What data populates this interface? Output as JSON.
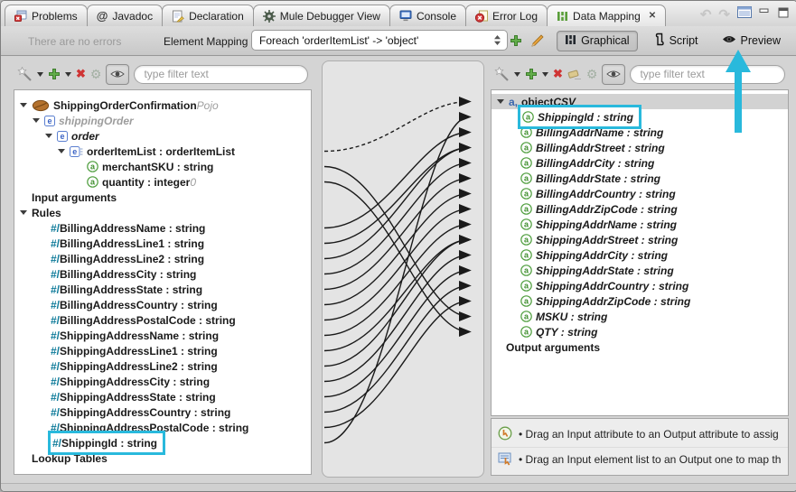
{
  "tabbar": {
    "tabs": [
      {
        "label": "Problems",
        "icon": "problems"
      },
      {
        "label": "Javadoc",
        "icon": "javadoc"
      },
      {
        "label": "Declaration",
        "icon": "declaration"
      },
      {
        "label": "Mule Debugger View",
        "icon": "mule-debugger"
      },
      {
        "label": "Console",
        "icon": "console"
      },
      {
        "label": "Error Log",
        "icon": "error-log"
      },
      {
        "label": "Data Mapping",
        "icon": "data-mapping",
        "active": true,
        "closable": true
      }
    ]
  },
  "toolbar": {
    "status": "There are no errors",
    "element_mapping_label": "Element Mapping",
    "mapping_select_value": "Foreach 'orderItemList' -> 'object'",
    "views": {
      "graphical": "Graphical",
      "script": "Script",
      "preview": "Preview",
      "active": "Graphical"
    }
  },
  "left_panel": {
    "filter_placeholder": "type filter text",
    "rows": [
      {
        "ind": 6,
        "exp": true,
        "icon": "bean",
        "segs": [
          [
            "ShippingOrderConfirmation ",
            "b"
          ],
          [
            "Pojo",
            "gi"
          ]
        ]
      },
      {
        "ind": 20,
        "exp": true,
        "icon": "e",
        "segs": [
          [
            "shippingOrder",
            "gib"
          ]
        ]
      },
      {
        "ind": 34,
        "exp": true,
        "icon": "e",
        "segs": [
          [
            "order",
            "i"
          ]
        ]
      },
      {
        "ind": 48,
        "exp": true,
        "icon": "elist",
        "segs": [
          [
            "orderItemList : orderItemList",
            "b"
          ]
        ]
      },
      {
        "ind": 80,
        "icon": "a",
        "segs": [
          [
            "merchantSKU : string",
            "b"
          ]
        ]
      },
      {
        "ind": 80,
        "icon": "a",
        "segs": [
          [
            "quantity : integer ",
            "b"
          ],
          [
            "0",
            "gi"
          ]
        ]
      },
      {
        "ind": 19,
        "segs": [
          [
            "Input arguments",
            "b"
          ]
        ]
      },
      {
        "ind": 6,
        "exp": true,
        "segs": [
          [
            "Rules",
            "b"
          ]
        ]
      },
      {
        "ind": 40,
        "segs": [
          [
            "#/ ",
            "hash"
          ],
          [
            "BillingAddressName : string",
            "b"
          ]
        ]
      },
      {
        "ind": 40,
        "segs": [
          [
            "#/ ",
            "hash"
          ],
          [
            "BillingAddressLine1 : string",
            "b"
          ]
        ]
      },
      {
        "ind": 40,
        "segs": [
          [
            "#/ ",
            "hash"
          ],
          [
            "BillingAddressLine2 : string",
            "b"
          ]
        ]
      },
      {
        "ind": 40,
        "segs": [
          [
            "#/ ",
            "hash"
          ],
          [
            "BillingAddressCity : string",
            "b"
          ]
        ]
      },
      {
        "ind": 40,
        "segs": [
          [
            "#/ ",
            "hash"
          ],
          [
            "BillingAddressState : string",
            "b"
          ]
        ]
      },
      {
        "ind": 40,
        "segs": [
          [
            "#/ ",
            "hash"
          ],
          [
            "BillingAddressCountry : string",
            "b"
          ]
        ]
      },
      {
        "ind": 40,
        "segs": [
          [
            "#/ ",
            "hash"
          ],
          [
            "BillingAddressPostalCode : string",
            "b"
          ]
        ]
      },
      {
        "ind": 40,
        "segs": [
          [
            "#/ ",
            "hash"
          ],
          [
            "ShippingAddressName : string",
            "b"
          ]
        ]
      },
      {
        "ind": 40,
        "segs": [
          [
            "#/ ",
            "hash"
          ],
          [
            "ShippingAddressLine1 : string",
            "b"
          ]
        ]
      },
      {
        "ind": 40,
        "segs": [
          [
            "#/ ",
            "hash"
          ],
          [
            "ShippingAddressLine2 : string",
            "b"
          ]
        ]
      },
      {
        "ind": 40,
        "segs": [
          [
            "#/ ",
            "hash"
          ],
          [
            "ShippingAddressCity : string",
            "b"
          ]
        ]
      },
      {
        "ind": 40,
        "segs": [
          [
            "#/ ",
            "hash"
          ],
          [
            "ShippingAddressState : string",
            "b"
          ]
        ]
      },
      {
        "ind": 40,
        "segs": [
          [
            "#/ ",
            "hash"
          ],
          [
            "ShippingAddressCountry : string",
            "b"
          ]
        ]
      },
      {
        "ind": 40,
        "segs": [
          [
            "#/ ",
            "hash"
          ],
          [
            "ShippingAddressPostalCode : string",
            "b"
          ]
        ]
      },
      {
        "ind": 40,
        "hl": true,
        "segs": [
          [
            "#/ ",
            "hash"
          ],
          [
            "ShippingId : string",
            "b"
          ]
        ]
      },
      {
        "ind": 19,
        "segs": [
          [
            "Lookup Tables",
            "b"
          ]
        ]
      }
    ]
  },
  "right_panel": {
    "filter_placeholder": "type filter text",
    "rows": [
      {
        "ind": 6,
        "exp": true,
        "icon": "acomma",
        "band": true,
        "segs": [
          [
            "object ",
            "b"
          ],
          [
            "CSV",
            "i"
          ]
        ]
      },
      {
        "ind": 32,
        "icon": "a",
        "hl": true,
        "segs": [
          [
            "ShippingId : string",
            "i"
          ]
        ]
      },
      {
        "ind": 32,
        "icon": "a",
        "segs": [
          [
            "BillingAddrName : string",
            "i"
          ]
        ]
      },
      {
        "ind": 32,
        "icon": "a",
        "segs": [
          [
            "BillingAddrStreet : string",
            "i"
          ]
        ]
      },
      {
        "ind": 32,
        "icon": "a",
        "segs": [
          [
            "BillingAddrCity : string",
            "i"
          ]
        ]
      },
      {
        "ind": 32,
        "icon": "a",
        "segs": [
          [
            "BillingAddrState : string",
            "i"
          ]
        ]
      },
      {
        "ind": 32,
        "icon": "a",
        "segs": [
          [
            "BillingAddrCountry : string",
            "i"
          ]
        ]
      },
      {
        "ind": 32,
        "icon": "a",
        "segs": [
          [
            "BillingAddrZipCode : string",
            "i"
          ]
        ]
      },
      {
        "ind": 32,
        "icon": "a",
        "segs": [
          [
            "ShippingAddrName : string",
            "i"
          ]
        ]
      },
      {
        "ind": 32,
        "icon": "a",
        "segs": [
          [
            "ShippingAddrStreet : string",
            "i"
          ]
        ]
      },
      {
        "ind": 32,
        "icon": "a",
        "segs": [
          [
            "ShippingAddrCity : string",
            "i"
          ]
        ]
      },
      {
        "ind": 32,
        "icon": "a",
        "segs": [
          [
            "ShippingAddrState : string",
            "i"
          ]
        ]
      },
      {
        "ind": 32,
        "icon": "a",
        "segs": [
          [
            "ShippingAddrCountry : string",
            "i"
          ]
        ]
      },
      {
        "ind": 32,
        "icon": "a",
        "segs": [
          [
            "ShippingAddrZipCode : string",
            "i"
          ]
        ]
      },
      {
        "ind": 32,
        "icon": "a",
        "segs": [
          [
            "MSKU : string",
            "i"
          ]
        ]
      },
      {
        "ind": 32,
        "icon": "a",
        "segs": [
          [
            "QTY : string",
            "i"
          ]
        ]
      },
      {
        "ind": 16,
        "segs": [
          [
            "Output arguments",
            "b"
          ]
        ]
      }
    ],
    "hints": [
      {
        "icon": "hint-attribute",
        "text": "• Drag an Input attribute to an Output attribute to assig"
      },
      {
        "icon": "hint-element-list",
        "text": "• Drag an Input element list to an Output one to map th"
      }
    ]
  },
  "connections": [
    {
      "from": 3,
      "to": 0,
      "dashed": true
    },
    {
      "from": 4,
      "to": 14
    },
    {
      "from": 5,
      "to": 15
    },
    {
      "from": 8,
      "to": 2
    },
    {
      "from": 9,
      "to": 3
    },
    {
      "from": 10,
      "to": 3
    },
    {
      "from": 11,
      "to": 4
    },
    {
      "from": 12,
      "to": 5
    },
    {
      "from": 13,
      "to": 6
    },
    {
      "from": 14,
      "to": 7
    },
    {
      "from": 15,
      "to": 8
    },
    {
      "from": 16,
      "to": 9
    },
    {
      "from": 17,
      "to": 9
    },
    {
      "from": 18,
      "to": 10
    },
    {
      "from": 19,
      "to": 11
    },
    {
      "from": 20,
      "to": 12
    },
    {
      "from": 21,
      "to": 13
    },
    {
      "from": 22,
      "to": 1
    }
  ],
  "colors": {
    "accent_cyan": "#29b9dc",
    "rule_prefix_teal": "#0d7a99",
    "attribute_green": "#4f9e3e",
    "element_blue": "#3b63c4",
    "error_red": "#d43a3a",
    "plus_green": "#62ad4a",
    "line_black": "#1a1a1a"
  }
}
